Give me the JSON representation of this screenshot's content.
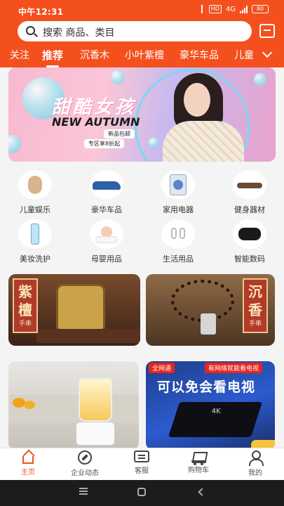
{
  "status_bar": {
    "time": "中午12:31",
    "hd": "HD",
    "signal": "4G",
    "battery": "80"
  },
  "search": {
    "placeholder": "搜索 商品、类目"
  },
  "tabs": [
    {
      "label": "关注",
      "active": false
    },
    {
      "label": "推荐",
      "active": true
    },
    {
      "label": "沉香木",
      "active": false
    },
    {
      "label": "小叶紫檀",
      "active": false
    },
    {
      "label": "豪华车品",
      "active": false
    },
    {
      "label": "儿童",
      "active": false
    }
  ],
  "banner": {
    "title_cn": "甜酷女孩",
    "title_en": "NEW AUTUMN",
    "tag_shipping": "新品包邮",
    "tag_discount": "专区享8折起"
  },
  "categories": [
    {
      "label": "儿童娱乐",
      "icon": "kids-toy-icon"
    },
    {
      "label": "豪华车品",
      "icon": "car-icon"
    },
    {
      "label": "家用电器",
      "icon": "washing-machine-icon"
    },
    {
      "label": "健身器材",
      "icon": "fitness-icon"
    },
    {
      "label": "美妆洗护",
      "icon": "skincare-icon"
    },
    {
      "label": "母婴用品",
      "icon": "baby-icon"
    },
    {
      "label": "生活用品",
      "icon": "earrings-icon"
    },
    {
      "label": "智能数码",
      "icon": "earbuds-icon"
    }
  ],
  "promos": {
    "zitan": {
      "big1": "紫",
      "big2": "檀",
      "small": "手串"
    },
    "chenxiang": {
      "big1": "沉",
      "big2": "香",
      "small": "手串"
    },
    "tv": {
      "chip_left": "全网通",
      "chip_right": "有网络就能看电视",
      "headline": "可以免会看电视",
      "box_label": "4K"
    }
  },
  "bottom_nav": [
    {
      "label": "主页",
      "active": true
    },
    {
      "label": "企业动态",
      "active": false
    },
    {
      "label": "客服",
      "active": false
    },
    {
      "label": "购物车",
      "active": false
    },
    {
      "label": "我的",
      "active": false
    }
  ],
  "colors": {
    "brand": "#f4501e",
    "active_tab": "#ffffff",
    "nav_active": "#f4501e"
  }
}
